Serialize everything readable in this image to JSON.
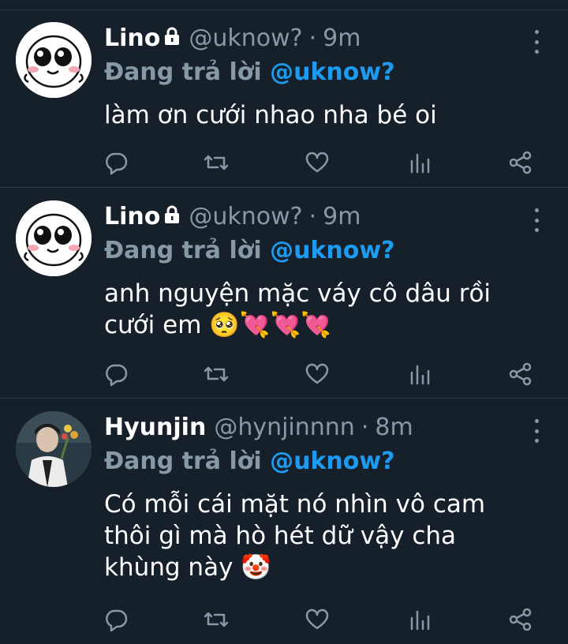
{
  "tweets": [
    {
      "name": "Lino",
      "handle": "@uknow?",
      "dot": "·",
      "time": "9m",
      "replying_prefix": "Đang trả lời",
      "replying_to": "@uknow?",
      "text": "làm ơn cưới nhao nha bé oi",
      "avatar": "cartoon-blob-avatar"
    },
    {
      "name": "Lino",
      "handle": "@uknow?",
      "dot": "·",
      "time": "9m",
      "replying_prefix": "Đang trả lời",
      "replying_to": "@uknow?",
      "text": "anh nguyện mặc váy cô dâu rồi cưới em 🥺💘💘💘",
      "avatar": "cartoon-blob-avatar"
    },
    {
      "name": "Hyunjin",
      "handle": "@hynjinnnn",
      "dot": "·",
      "time": "8m",
      "replying_prefix": "Đang trả lời",
      "replying_to": "@uknow?",
      "text": "Có mỗi cái mặt nó nhìn vô cam thôi gì mà hò hét dữ vậy cha khùng này 🤡",
      "avatar": "photo-avatar"
    }
  ],
  "icons": {
    "reply": "reply-icon",
    "retweet": "retweet-icon",
    "like": "heart-icon",
    "stats": "analytics-icon",
    "share": "share-icon",
    "lock": "lock-icon",
    "more": "more-vertical-icon"
  },
  "colors": {
    "background": "#15202b",
    "divider": "#2f3b47",
    "muted": "#8899a6",
    "mention": "#1d9bf0",
    "text": "#ffffff"
  }
}
